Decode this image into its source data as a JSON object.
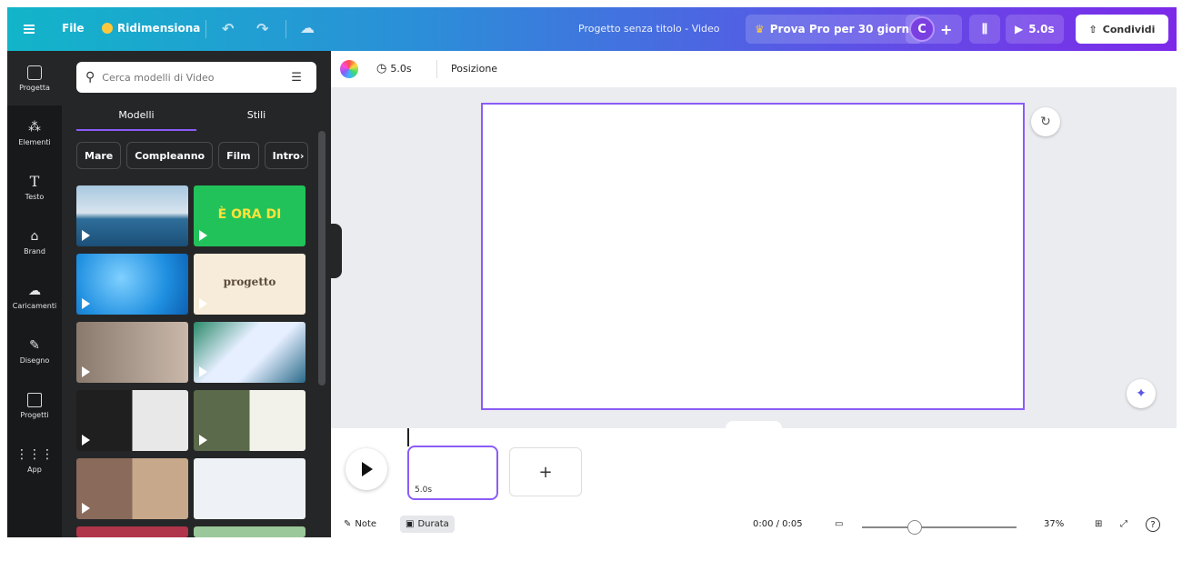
{
  "topbar": {
    "file_label": "File",
    "resize_label": "Ridimensiona",
    "project_title": "Progetto senza titolo - Video",
    "pro_label": "Prova Pro per 30 giorni",
    "avatar_letter": "C",
    "plus": "+",
    "play_duration": "5.0s",
    "share_label": "Condividi"
  },
  "rail": {
    "items": [
      {
        "label": "Progetta",
        "icon": "layout-icon"
      },
      {
        "label": "Elementi",
        "icon": "shapes-icon"
      },
      {
        "label": "Testo",
        "icon": "text-icon"
      },
      {
        "label": "Brand",
        "icon": "brand-icon"
      },
      {
        "label": "Caricamenti",
        "icon": "upload-icon"
      },
      {
        "label": "Disegno",
        "icon": "draw-icon"
      },
      {
        "label": "Progetti",
        "icon": "folder-icon"
      },
      {
        "label": "App",
        "icon": "apps-icon"
      }
    ]
  },
  "panel": {
    "search_placeholder": "Cerca modelli di Video",
    "tabs": [
      "Modelli",
      "Stili"
    ],
    "chips": [
      "Mare",
      "Compleanno",
      "Film",
      "Intro"
    ],
    "thumb_texts": [
      "",
      "È ORA DI",
      "",
      "progetto",
      "",
      "",
      "",
      "",
      "",
      ""
    ]
  },
  "canvas_toolbar": {
    "duration": "5.0s",
    "position_label": "Posizione"
  },
  "timeline": {
    "clip_duration": "5.0s",
    "add": "+",
    "notes_label": "Note",
    "duration_label": "Durata",
    "time": "0:00 / 0:05",
    "zoom": "37%",
    "zoom_level": 0.3
  },
  "colors": {
    "accent": "#8b5cf6",
    "rail_bg": "#18191b",
    "panel_bg": "#252627"
  }
}
